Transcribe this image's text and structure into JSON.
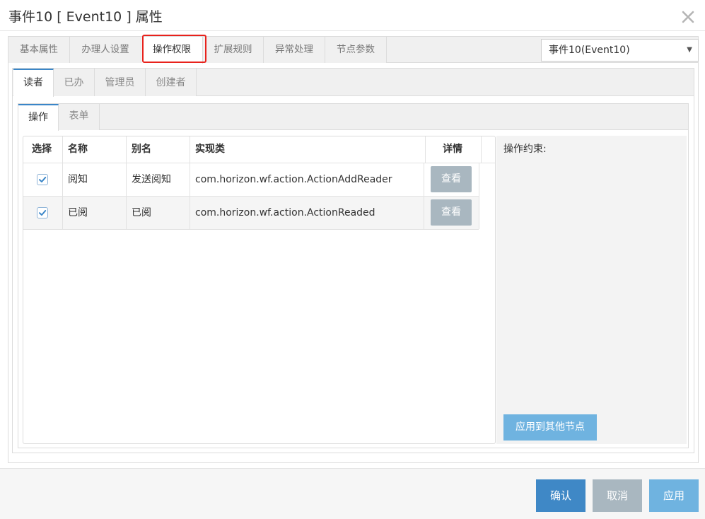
{
  "dialog": {
    "title": "事件10 [ Event10 ] 属性",
    "close_icon": "close-icon"
  },
  "main_tabs": [
    {
      "label": "基本属性",
      "active": false
    },
    {
      "label": "办理人设置",
      "active": false
    },
    {
      "label": "操作权限",
      "active": true,
      "highlighted": true
    },
    {
      "label": "扩展规则",
      "active": false
    },
    {
      "label": "异常处理",
      "active": false
    },
    {
      "label": "节点参数",
      "active": false
    }
  ],
  "node_select": {
    "value": "事件10(Event10)",
    "arrow": "▼"
  },
  "role_tabs": [
    {
      "label": "读者",
      "active": true
    },
    {
      "label": "已办",
      "active": false
    },
    {
      "label": "管理员",
      "active": false
    },
    {
      "label": "创建者",
      "active": false
    }
  ],
  "section_tabs": [
    {
      "label": "操作",
      "active": true
    },
    {
      "label": "表单",
      "active": false
    }
  ],
  "table": {
    "headers": [
      "选择",
      "名称",
      "别名",
      "实现类",
      "详情"
    ],
    "rows": [
      {
        "checked": true,
        "name": "阅知",
        "alias": "发送阅知",
        "class": "com.horizon.wf.action.ActionAddReader",
        "detail_label": "查看"
      },
      {
        "checked": true,
        "name": "已阅",
        "alias": "已阅",
        "class": "com.horizon.wf.action.ActionReaded",
        "detail_label": "查看"
      }
    ]
  },
  "constraint": {
    "label": "操作约束:",
    "apply_to_other_label": "应用到其他节点"
  },
  "footer": {
    "confirm_label": "确认",
    "cancel_label": "取消",
    "apply_label": "应用"
  },
  "colors": {
    "primary": "#3f88c6",
    "light_primary": "#6fb3e0",
    "disabled": "#a9b7c0",
    "highlight": "#e8221c"
  }
}
